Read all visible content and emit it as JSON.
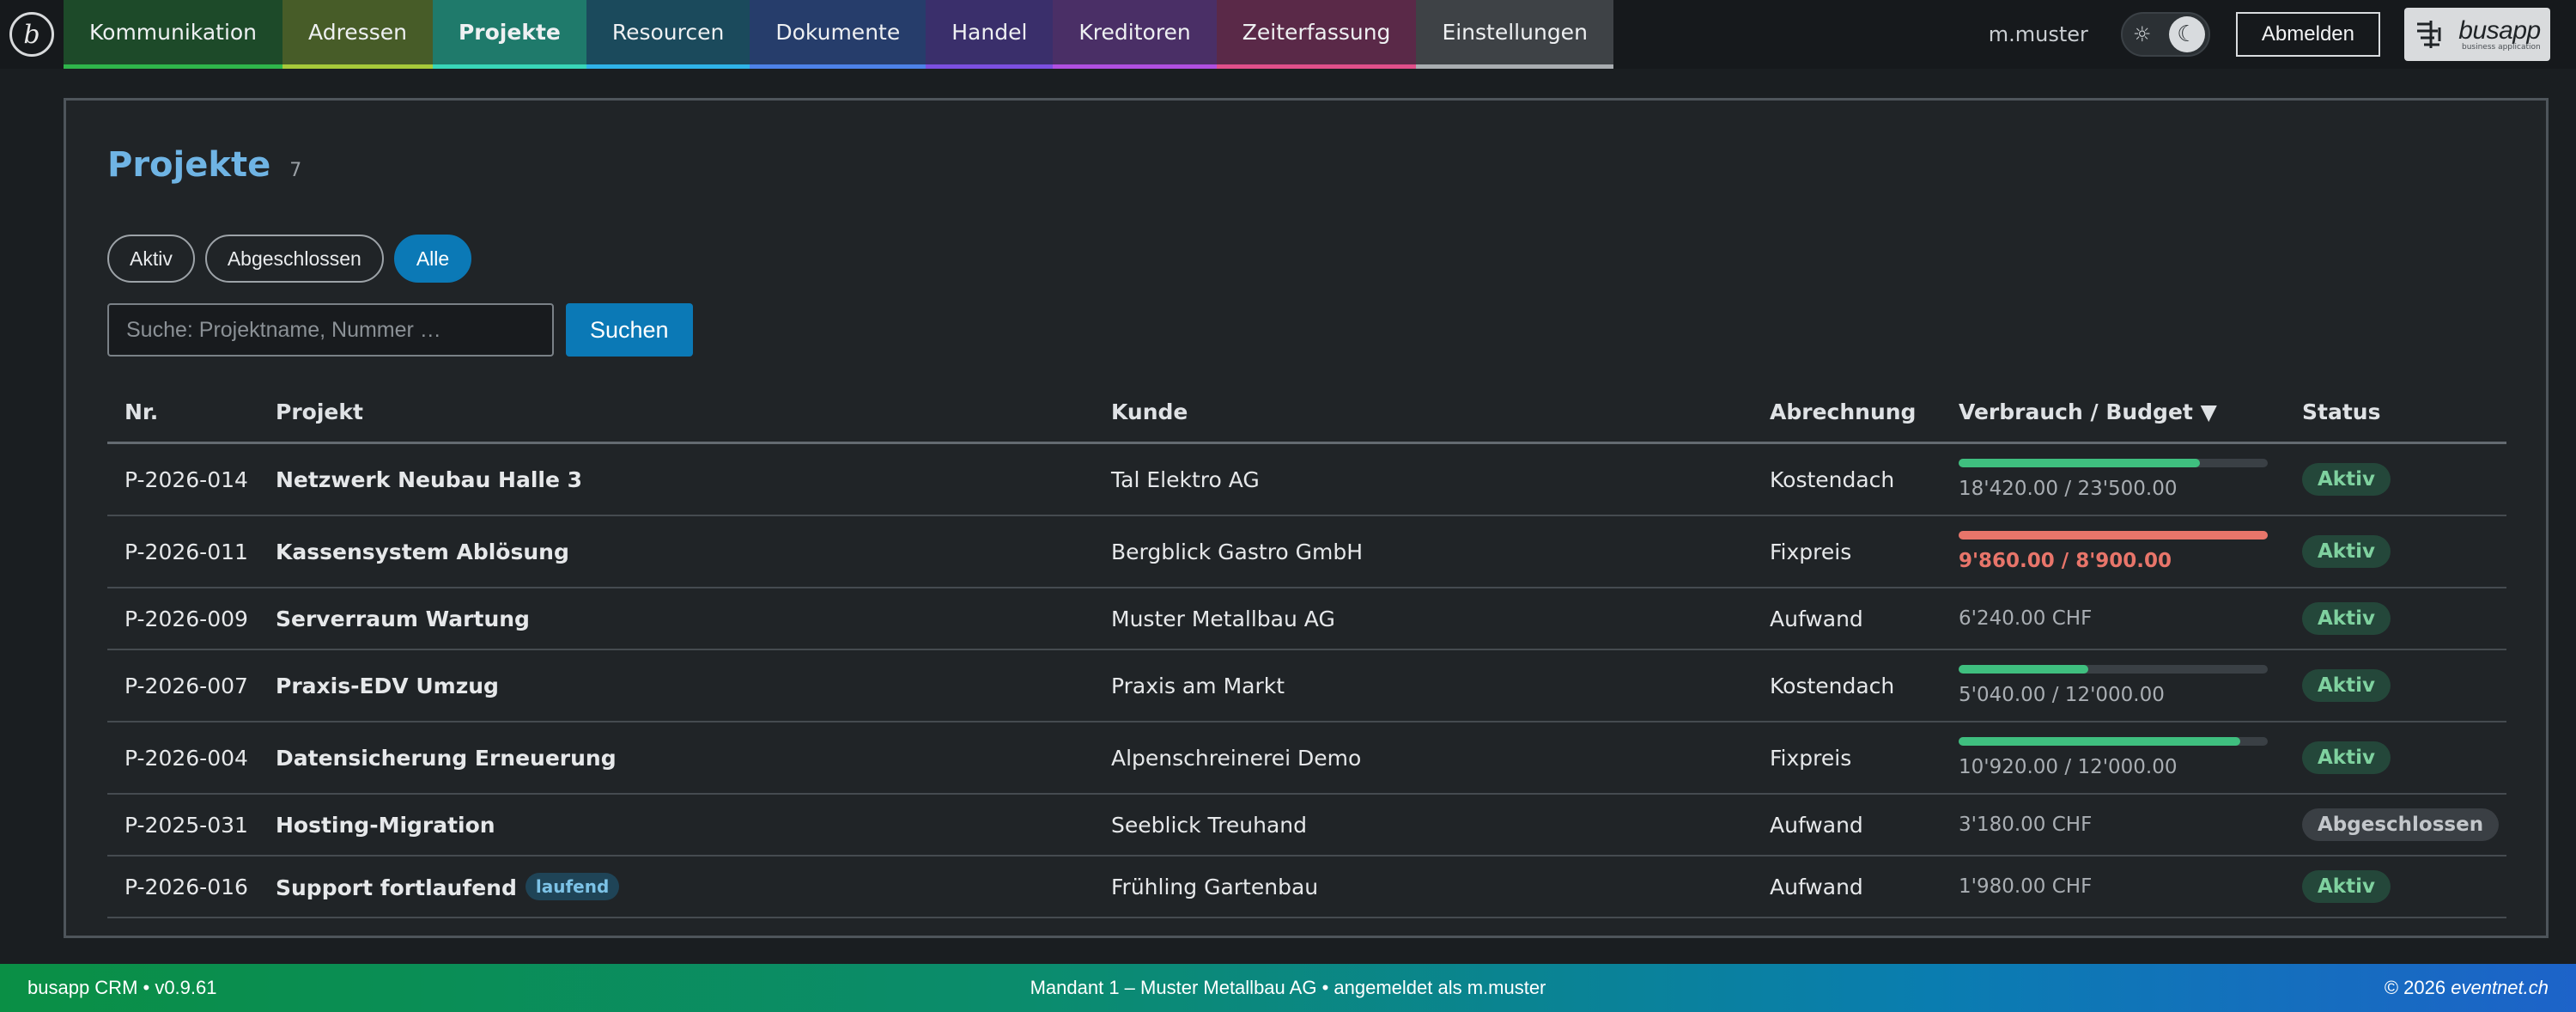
{
  "nav": {
    "logo_letter": "b",
    "tabs": [
      {
        "label": "Kommunikation",
        "bg": "#1d4a29",
        "bar": "#2fb54b"
      },
      {
        "label": "Adressen",
        "bg": "#475c28",
        "bar": "#a7c93a"
      },
      {
        "label": "Projekte",
        "bg": "#1f7a6b",
        "bar": "#39d6b8",
        "active": true
      },
      {
        "label": "Resourcen",
        "bg": "#1b4a5c",
        "bar": "#2fb3e8"
      },
      {
        "label": "Dokumente",
        "bg": "#263d6b",
        "bar": "#4d82e8"
      },
      {
        "label": "Handel",
        "bg": "#3a2f6b",
        "bar": "#7c4fe0"
      },
      {
        "label": "Kreditoren",
        "bg": "#4a2f66",
        "bar": "#b04fe0"
      },
      {
        "label": "Zeiterfassung",
        "bg": "#5a2948",
        "bar": "#e04f8a"
      },
      {
        "label": "Einstellungen",
        "bg": "#3e4246",
        "bar": "#a9adb1"
      }
    ],
    "username": "m.muster",
    "logout_label": "Abmelden",
    "brand_name": "busapp",
    "brand_sub": "business application"
  },
  "page": {
    "title": "Projekte",
    "count": "7",
    "filters": [
      {
        "label": "Aktiv",
        "active": false
      },
      {
        "label": "Abgeschlossen",
        "active": false
      },
      {
        "label": "Alle",
        "active": true
      }
    ],
    "search_placeholder": "Suche: Projektname, Nummer …",
    "search_button": "Suchen"
  },
  "table": {
    "headers": {
      "nr": "Nr.",
      "projekt": "Projekt",
      "kunde": "Kunde",
      "abrechnung": "Abrechnung",
      "verbrauch": "Verbrauch / Budget ▼",
      "status": "Status"
    },
    "rows": [
      {
        "nr": "P-2026-014",
        "projekt": "Netzwerk Neubau Halle 3",
        "tag": "",
        "kunde": "Tal Elektro AG",
        "abrechnung": "Kostendach",
        "bar": true,
        "progress": 0.78,
        "bar_color": "#3fbf7f",
        "amount": "18'420.00 / 23'500.00",
        "over": false,
        "status": "Aktiv",
        "status_type": "aktiv"
      },
      {
        "nr": "P-2026-011",
        "projekt": "Kassensystem Ablösung",
        "tag": "",
        "kunde": "Bergblick Gastro GmbH",
        "abrechnung": "Fixpreis",
        "bar": true,
        "progress": 1.0,
        "bar_color": "#e8756a",
        "amount": "9'860.00 / 8'900.00",
        "over": true,
        "status": "Aktiv",
        "status_type": "aktiv"
      },
      {
        "nr": "P-2026-009",
        "projekt": "Serverraum Wartung",
        "tag": "",
        "kunde": "Muster Metallbau AG",
        "abrechnung": "Aufwand",
        "bar": false,
        "amount": "6'240.00 CHF",
        "over": false,
        "status": "Aktiv",
        "status_type": "aktiv"
      },
      {
        "nr": "P-2026-007",
        "projekt": "Praxis-EDV Umzug",
        "tag": "",
        "kunde": "Praxis am Markt",
        "abrechnung": "Kostendach",
        "bar": true,
        "progress": 0.42,
        "bar_color": "#3fbf7f",
        "amount": "5'040.00 / 12'000.00",
        "over": false,
        "status": "Aktiv",
        "status_type": "aktiv"
      },
      {
        "nr": "P-2026-004",
        "projekt": "Datensicherung Erneuerung",
        "tag": "",
        "kunde": "Alpenschreinerei Demo",
        "abrechnung": "Fixpreis",
        "bar": true,
        "progress": 0.91,
        "bar_color": "#3fbf7f",
        "amount": "10'920.00 / 12'000.00",
        "over": false,
        "status": "Aktiv",
        "status_type": "aktiv"
      },
      {
        "nr": "P-2025-031",
        "projekt": "Hosting-Migration",
        "tag": "",
        "kunde": "Seeblick Treuhand",
        "abrechnung": "Aufwand",
        "bar": false,
        "amount": "3'180.00 CHF",
        "over": false,
        "status": "Abgeschlossen",
        "status_type": "closed"
      },
      {
        "nr": "P-2026-016",
        "projekt": "Support fortlaufend",
        "tag": "laufend",
        "kunde": "Frühling Gartenbau",
        "abrechnung": "Aufwand",
        "bar": false,
        "amount": "1'980.00 CHF",
        "over": false,
        "status": "Aktiv",
        "status_type": "aktiv"
      }
    ]
  },
  "footer": {
    "left": "busapp CRM • v0.9.61",
    "center": "Mandant 1 – Muster Metallbau AG • angemeldet als m.muster",
    "right_prefix": "© 2026 ",
    "right_brand": "eventnet.ch"
  }
}
